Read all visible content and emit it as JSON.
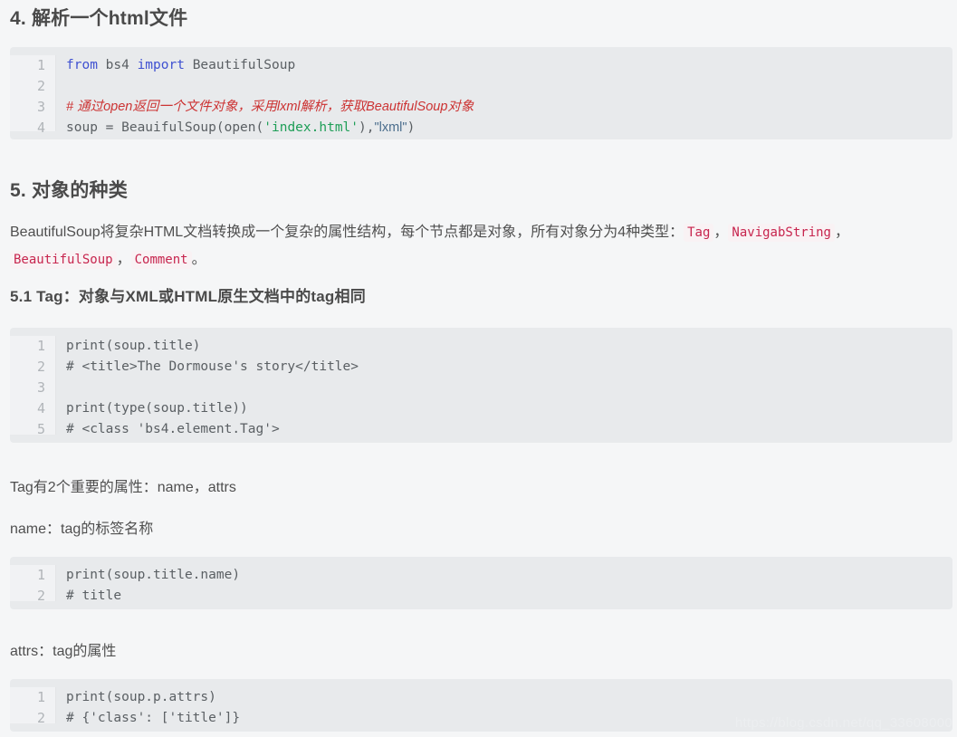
{
  "page": {
    "background": "#f5f6f7",
    "code_background": "#e8eaec",
    "gutter_background": "#f1f2f4",
    "inline_code_color": "#c7254e",
    "inline_code_background": "#f9f2f4",
    "heading_color": "#4a4a4a",
    "body_color": "#4f4f4f"
  },
  "watermark": {
    "text": "https://blog.csdn.net/qq_33608000"
  },
  "sections": [
    {
      "id": "sec-4",
      "heading": "4. 解析一个html文件"
    },
    {
      "id": "sec-5",
      "heading": "5. 对象的种类"
    },
    {
      "id": "sec-5-1",
      "heading": "5.1 Tag：对象与XML或HTML原生文档中的tag相同"
    }
  ],
  "paragraphs": {
    "object_types": {
      "lead": "BeautifulSoup将复杂HTML文档转换成一个复杂的属性结构，每个节点都是对象，所有对象分为4种类型：",
      "codes": [
        "Tag",
        "NavigabString",
        "BeautifulSoup",
        "Comment"
      ],
      "sep": "，",
      "period": "。"
    },
    "tag_attrs": "Tag有2个重要的属性：name，attrs",
    "name_desc": "name：tag的标签名称",
    "attrs_desc": "attrs：tag的属性"
  },
  "code_blocks": [
    {
      "id": "code-parse-html",
      "line_numbers": [
        "1",
        "2",
        "3",
        "4"
      ],
      "lines": [
        [
          {
            "t": "from",
            "c": "kw"
          },
          {
            "t": " bs4 ",
            "c": "plain"
          },
          {
            "t": "import",
            "c": "kw"
          },
          {
            "t": " BeautifulSoup",
            "c": "plain"
          }
        ],
        [],
        [
          {
            "t": "# 通过open返回一个文件对象，采用lxml解析，获取BeautifulSoup对象",
            "c": "comment"
          }
        ],
        [
          {
            "t": "soup = BeauifulSoup(open(",
            "c": "plain"
          },
          {
            "t": "'index.html'",
            "c": "str"
          },
          {
            "t": "),",
            "c": "punct"
          },
          {
            "t": "\"lxml\"",
            "c": "str2"
          },
          {
            "t": ")",
            "c": "punct"
          }
        ]
      ]
    },
    {
      "id": "code-tag-title",
      "line_numbers": [
        "1",
        "2",
        "3",
        "4",
        "5"
      ],
      "lines": [
        [
          {
            "t": "print(soup.title)",
            "c": "plain"
          }
        ],
        [
          {
            "t": "# <title>The Dormouse's story</title>",
            "c": "plain"
          }
        ],
        [],
        [
          {
            "t": "print(type(soup.title))",
            "c": "plain"
          }
        ],
        [
          {
            "t": "# <class 'bs4.element.Tag'>",
            "c": "plain"
          }
        ]
      ]
    },
    {
      "id": "code-tag-name",
      "line_numbers": [
        "1",
        "2"
      ],
      "lines": [
        [
          {
            "t": "print(soup.title.name)",
            "c": "plain"
          }
        ],
        [
          {
            "t": "# title",
            "c": "plain"
          }
        ]
      ]
    },
    {
      "id": "code-tag-attrs",
      "line_numbers": [
        "1",
        "2"
      ],
      "lines": [
        [
          {
            "t": "print(soup.p.attrs)",
            "c": "plain"
          }
        ],
        [
          {
            "t": "# {'class': ['title']}",
            "c": "plain"
          }
        ]
      ]
    }
  ]
}
